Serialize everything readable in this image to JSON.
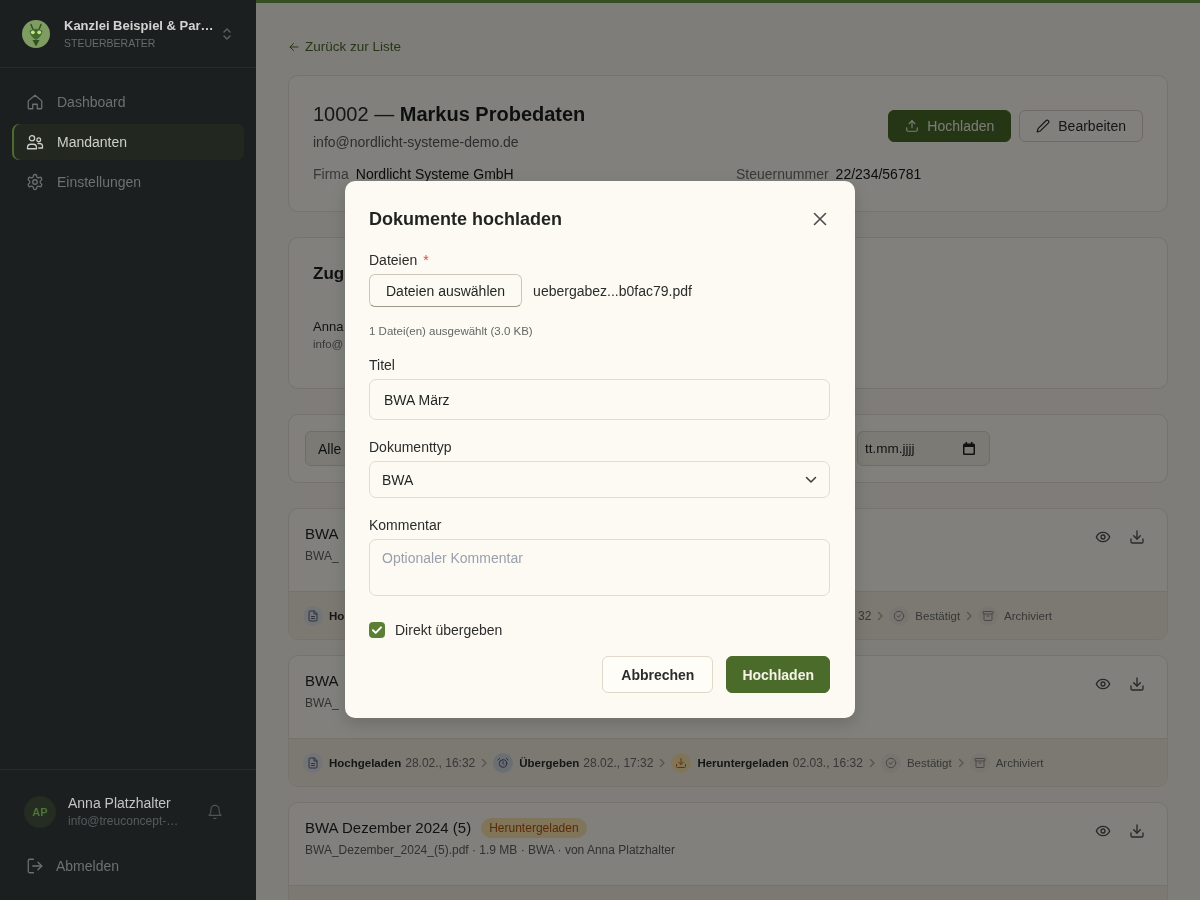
{
  "sidebar": {
    "org_name": "Kanzlei Beispiel & Par…",
    "org_role": "STEUERBERATER",
    "nav": [
      {
        "label": "Dashboard",
        "selected": false
      },
      {
        "label": "Mandanten",
        "selected": true
      },
      {
        "label": "Einstellungen",
        "selected": false
      }
    ],
    "user": {
      "initials": "AP",
      "name": "Anna Platzhalter",
      "email": "info@treuconcept-…"
    },
    "logout": "Abmelden"
  },
  "back_link": "Zurück zur Liste",
  "client": {
    "heading": "10002 — **Markus Probedaten**",
    "email": "info@nordlicht-systeme-demo.de",
    "actions": [
      {
        "label": "Hochladen",
        "kind": "primary"
      },
      {
        "label": "Bearbeiten",
        "kind": "secondary"
      }
    ],
    "fields": [
      {
        "label": "Firma",
        "value": "Nordlicht Systeme GmbH"
      },
      {
        "label": "Steuernummer",
        "value": "22/234/56781"
      }
    ]
  },
  "assignment": {
    "title": "Zug",
    "contact_name": "Anna",
    "contact_email": "info@"
  },
  "filters": {
    "type_filter": "Alle",
    "date_placeholder": "tt.mm.jjjj"
  },
  "documents": [
    {
      "title": "BWA",
      "filename": "BWA_",
      "timeline": [
        {
          "kind": "upload",
          "label": "Ho",
          "done": true
        }
      ],
      "timeline_right": [
        {
          "date": "32"
        },
        {
          "kind": "confirm",
          "label": "Bestätigt",
          "done": false
        },
        {
          "kind": "archive",
          "label": "Archiviert",
          "done": false
        }
      ]
    },
    {
      "title": "BWA",
      "filename": "BWA_",
      "timeline": [
        {
          "kind": "upload",
          "label": "Hochgeladen",
          "date": "28.02., 16:32",
          "done": true
        },
        {
          "kind": "handover",
          "label": "Übergeben",
          "date": "28.02., 17:32",
          "done": true
        },
        {
          "kind": "download",
          "label": "Heruntergeladen",
          "date": "02.03., 16:32",
          "done": true
        },
        {
          "kind": "confirm",
          "label": "Bestätigt",
          "done": false
        },
        {
          "kind": "archive",
          "label": "Archiviert",
          "done": false
        }
      ]
    },
    {
      "title": "BWA Dezember 2024 (5)",
      "badge": {
        "label": "Heruntergeladen",
        "kind": "downloaded"
      },
      "filename": "BWA_Dezember_2024_(5).pdf · 1.9 MB · BWA · von Anna Platzhalter"
    }
  ],
  "upload_dialog": {
    "title": "Dokumente hochladen",
    "files": {
      "label": "Dateien",
      "required_mark": "*",
      "button": "Dateien auswählen",
      "file_name": "uebergabez...b0fac79.pdf",
      "info": "1 Datei(en) ausgewählt (3.0 KB)"
    },
    "fields": [
      {
        "kind": "text",
        "label": "Titel",
        "value": "BWA März"
      },
      {
        "kind": "select",
        "label": "Dokumenttyp",
        "value": "BWA"
      },
      {
        "kind": "textarea",
        "label": "Kommentar",
        "placeholder": "Optionaler Kommentar"
      }
    ],
    "direct_handover": {
      "label": "Direkt übergeben",
      "checked": true
    },
    "buttons": [
      {
        "kind": "secondary",
        "label": "Abbrechen"
      },
      {
        "kind": "primary",
        "label": "Hochladen"
      }
    ]
  }
}
